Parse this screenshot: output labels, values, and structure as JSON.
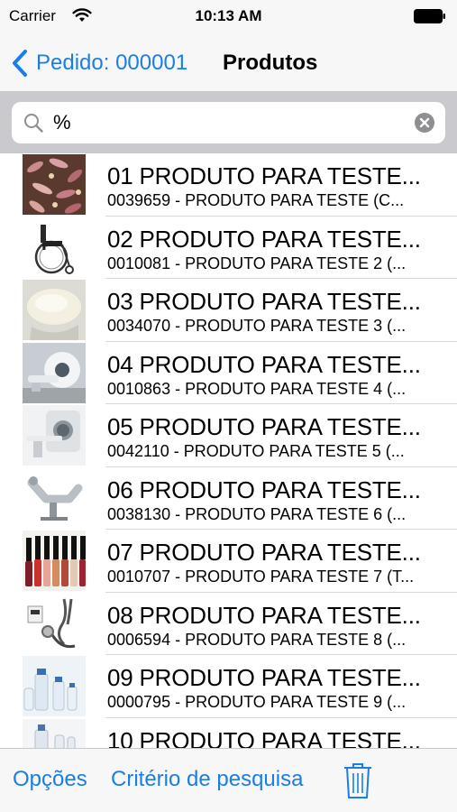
{
  "status_bar": {
    "carrier": "Carrier",
    "time": "10:13 AM"
  },
  "nav": {
    "back_label": "Pedido: 000001",
    "title": "Produtos",
    "accent_color": "#1a7ee6"
  },
  "search": {
    "value": "%",
    "placeholder": ""
  },
  "products": [
    {
      "title": "01 PRODUTO PARA TESTE...",
      "subtitle": "0039659 - PRODUTO PARA TESTE (C...",
      "image": "food-image"
    },
    {
      "title": "02 PRODUTO PARA TESTE...",
      "subtitle": "0010081 - PRODUTO PARA TESTE 2 (...",
      "image": "wheelchair-image"
    },
    {
      "title": "03 PRODUTO PARA TESTE...",
      "subtitle": "0034070 - PRODUTO PARA TESTE 3 (...",
      "image": "cream-image"
    },
    {
      "title": "04 PRODUTO PARA TESTE...",
      "subtitle": "0010863 - PRODUTO PARA TESTE 4 (...",
      "image": "scanner-machine-image"
    },
    {
      "title": "05 PRODUTO PARA TESTE...",
      "subtitle": "0042110 - PRODUTO PARA TESTE 5 (...",
      "image": "mri-machine-image"
    },
    {
      "title": "06 PRODUTO PARA TESTE...",
      "subtitle": "0038130 - PRODUTO PARA TESTE 6 (...",
      "image": "medical-chair-image"
    },
    {
      "title": "07 PRODUTO PARA TESTE...",
      "subtitle": "0010707 - PRODUTO PARA TESTE 7 (T...",
      "image": "nail-polish-image"
    },
    {
      "title": "08 PRODUTO PARA TESTE...",
      "subtitle": "0006594 - PRODUTO PARA TESTE 8 (...",
      "image": "stethoscope-image"
    },
    {
      "title": "09 PRODUTO PARA TESTE...",
      "subtitle": "0000795 - PRODUTO PARA TESTE 9 (...",
      "image": "vials-image"
    },
    {
      "title": "10 PRODUTO PARA TESTE...",
      "subtitle": "",
      "image": "bottles-image"
    }
  ],
  "toolbar": {
    "options_label": "Opções",
    "criteria_label": "Critério de pesquisa",
    "trash_icon": "trash-icon"
  }
}
